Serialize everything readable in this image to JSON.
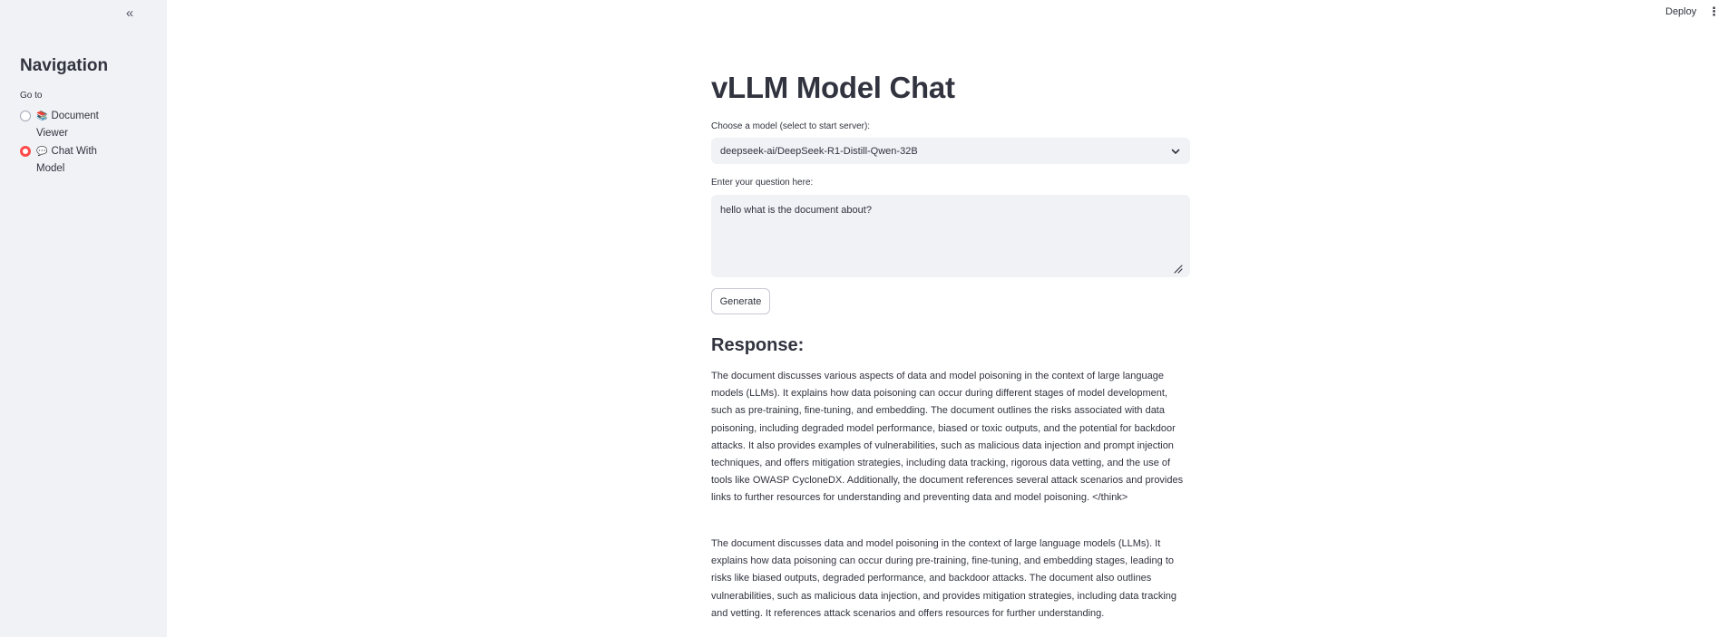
{
  "sidebar": {
    "collapse_glyph": "«",
    "title": "Navigation",
    "radio_label": "Go to",
    "items": [
      {
        "emoji": "📚",
        "label": "Document Viewer",
        "selected": false
      },
      {
        "emoji": "💬",
        "label": "Chat With Model",
        "selected": true
      }
    ]
  },
  "topbar": {
    "deploy_label": "Deploy",
    "menu_glyph": "⋮"
  },
  "main": {
    "title": "vLLM Model Chat",
    "model_label": "Choose a model (select to start server):",
    "model_value": "deepseek-ai/DeepSeek-R1-Distill-Qwen-32B",
    "question_label": "Enter your question here:",
    "question_value": "hello what is the document about?",
    "generate_label": "Generate",
    "response_heading": "Response:",
    "response_paragraphs": [
      "The document discusses various aspects of data and model poisoning in the context of large language models (LLMs). It explains how data poisoning can occur during different stages of model development, such as pre-training, fine-tuning, and embedding. The document outlines the risks associated with data poisoning, including degraded model performance, biased or toxic outputs, and the potential for backdoor attacks. It also provides examples of vulnerabilities, such as malicious data injection and prompt injection techniques, and offers mitigation strategies, including data tracking, rigorous data vetting, and the use of tools like OWASP CycloneDX. Additionally, the document references several attack scenarios and provides links to further resources for understanding and preventing data and model poisoning. </think>",
      "The document discusses data and model poisoning in the context of large language models (LLMs). It explains how data poisoning can occur during pre-training, fine-tuning, and embedding stages, leading to risks like biased outputs, degraded performance, and backdoor attacks. The document also outlines vulnerabilities, such as malicious data injection, and provides mitigation strategies, including data tracking and vetting. It references attack scenarios and offers resources for further understanding."
    ]
  },
  "colors": {
    "sidebar_bg": "#f0f2f6",
    "accent": "#ff4b4b",
    "text": "#31333f",
    "input_bg": "#f0f2f6"
  }
}
